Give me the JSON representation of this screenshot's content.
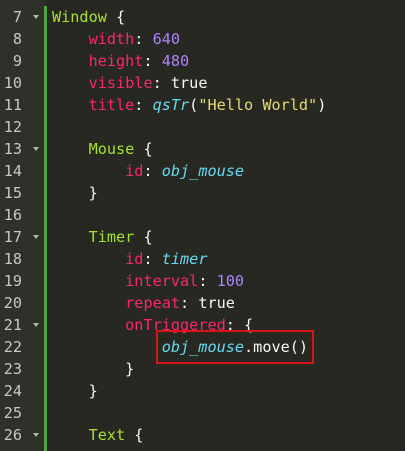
{
  "editor": {
    "lines": [
      {
        "num": "7",
        "fold": true,
        "tokens": [
          {
            "c": "t",
            "v": "Window"
          },
          {
            "c": "b",
            "v": " {"
          }
        ]
      },
      {
        "num": "8",
        "fold": false,
        "tokens": [
          {
            "c": "b",
            "v": "    "
          },
          {
            "c": "p",
            "v": "width"
          },
          {
            "c": "b",
            "v": ": "
          },
          {
            "c": "n",
            "v": "640"
          }
        ]
      },
      {
        "num": "9",
        "fold": false,
        "tokens": [
          {
            "c": "b",
            "v": "    "
          },
          {
            "c": "p",
            "v": "height"
          },
          {
            "c": "b",
            "v": ": "
          },
          {
            "c": "n",
            "v": "480"
          }
        ]
      },
      {
        "num": "10",
        "fold": false,
        "tokens": [
          {
            "c": "b",
            "v": "    "
          },
          {
            "c": "p",
            "v": "visible"
          },
          {
            "c": "b",
            "v": ": "
          },
          {
            "c": "b",
            "v": "true"
          }
        ]
      },
      {
        "num": "11",
        "fold": false,
        "tokens": [
          {
            "c": "b",
            "v": "    "
          },
          {
            "c": "p",
            "v": "title"
          },
          {
            "c": "b",
            "v": ": "
          },
          {
            "c": "i",
            "v": "qsTr"
          },
          {
            "c": "b",
            "v": "("
          },
          {
            "c": "s",
            "v": "\"Hello World\""
          },
          {
            "c": "b",
            "v": ")"
          }
        ]
      },
      {
        "num": "12",
        "fold": false,
        "tokens": []
      },
      {
        "num": "13",
        "fold": true,
        "tokens": [
          {
            "c": "b",
            "v": "    "
          },
          {
            "c": "t",
            "v": "Mouse"
          },
          {
            "c": "b",
            "v": " {"
          }
        ]
      },
      {
        "num": "14",
        "fold": false,
        "tokens": [
          {
            "c": "b",
            "v": "        "
          },
          {
            "c": "p",
            "v": "id"
          },
          {
            "c": "b",
            "v": ": "
          },
          {
            "c": "i",
            "v": "obj_mouse"
          }
        ]
      },
      {
        "num": "15",
        "fold": false,
        "tokens": [
          {
            "c": "b",
            "v": "    }"
          }
        ]
      },
      {
        "num": "16",
        "fold": false,
        "tokens": []
      },
      {
        "num": "17",
        "fold": true,
        "tokens": [
          {
            "c": "b",
            "v": "    "
          },
          {
            "c": "t",
            "v": "Timer"
          },
          {
            "c": "b",
            "v": " {"
          }
        ]
      },
      {
        "num": "18",
        "fold": false,
        "tokens": [
          {
            "c": "b",
            "v": "        "
          },
          {
            "c": "p",
            "v": "id"
          },
          {
            "c": "b",
            "v": ": "
          },
          {
            "c": "i",
            "v": "timer"
          }
        ]
      },
      {
        "num": "19",
        "fold": false,
        "tokens": [
          {
            "c": "b",
            "v": "        "
          },
          {
            "c": "p",
            "v": "interval"
          },
          {
            "c": "b",
            "v": ": "
          },
          {
            "c": "n",
            "v": "100"
          }
        ]
      },
      {
        "num": "20",
        "fold": false,
        "tokens": [
          {
            "c": "b",
            "v": "        "
          },
          {
            "c": "p",
            "v": "repeat"
          },
          {
            "c": "b",
            "v": ": "
          },
          {
            "c": "b",
            "v": "true"
          }
        ]
      },
      {
        "num": "21",
        "fold": true,
        "tokens": [
          {
            "c": "b",
            "v": "        "
          },
          {
            "c": "p",
            "v": "onTriggered"
          },
          {
            "c": "b",
            "v": ": {"
          }
        ]
      },
      {
        "num": "22",
        "fold": false,
        "tokens": [
          {
            "c": "b",
            "v": "            "
          },
          {
            "c": "i",
            "v": "obj_mouse",
            "hl": "start"
          },
          {
            "c": "b",
            "v": ".move()",
            "hl": "end"
          }
        ]
      },
      {
        "num": "23",
        "fold": false,
        "tokens": [
          {
            "c": "b",
            "v": "        }"
          }
        ]
      },
      {
        "num": "24",
        "fold": false,
        "tokens": [
          {
            "c": "b",
            "v": "    }"
          }
        ]
      },
      {
        "num": "25",
        "fold": false,
        "tokens": []
      },
      {
        "num": "26",
        "fold": true,
        "tokens": [
          {
            "c": "b",
            "v": "    "
          },
          {
            "c": "t",
            "v": "Text"
          },
          {
            "c": "b",
            "v": " {"
          }
        ]
      }
    ],
    "highlight_color": "#d8141a",
    "change_bar_color": "#4fa83d"
  }
}
